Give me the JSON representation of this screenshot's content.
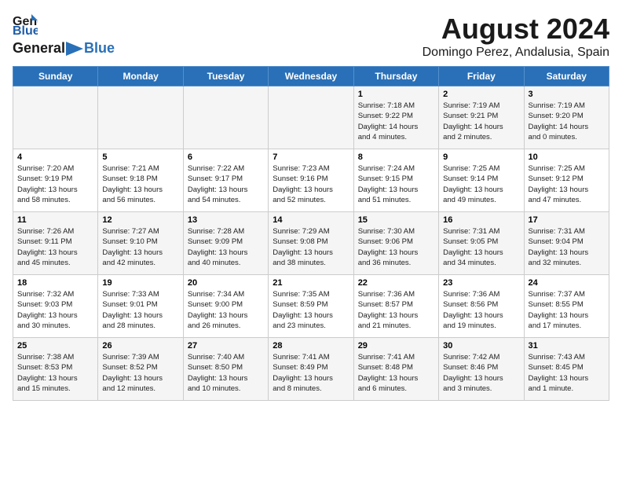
{
  "header": {
    "logo_general": "General",
    "logo_blue": "Blue",
    "month_year": "August 2024",
    "subtitle": "Domingo Perez, Andalusia, Spain"
  },
  "weekdays": [
    "Sunday",
    "Monday",
    "Tuesday",
    "Wednesday",
    "Thursday",
    "Friday",
    "Saturday"
  ],
  "weeks": [
    [
      {
        "day": "",
        "info": ""
      },
      {
        "day": "",
        "info": ""
      },
      {
        "day": "",
        "info": ""
      },
      {
        "day": "",
        "info": ""
      },
      {
        "day": "1",
        "info": "Sunrise: 7:18 AM\nSunset: 9:22 PM\nDaylight: 14 hours\nand 4 minutes."
      },
      {
        "day": "2",
        "info": "Sunrise: 7:19 AM\nSunset: 9:21 PM\nDaylight: 14 hours\nand 2 minutes."
      },
      {
        "day": "3",
        "info": "Sunrise: 7:19 AM\nSunset: 9:20 PM\nDaylight: 14 hours\nand 0 minutes."
      }
    ],
    [
      {
        "day": "4",
        "info": "Sunrise: 7:20 AM\nSunset: 9:19 PM\nDaylight: 13 hours\nand 58 minutes."
      },
      {
        "day": "5",
        "info": "Sunrise: 7:21 AM\nSunset: 9:18 PM\nDaylight: 13 hours\nand 56 minutes."
      },
      {
        "day": "6",
        "info": "Sunrise: 7:22 AM\nSunset: 9:17 PM\nDaylight: 13 hours\nand 54 minutes."
      },
      {
        "day": "7",
        "info": "Sunrise: 7:23 AM\nSunset: 9:16 PM\nDaylight: 13 hours\nand 52 minutes."
      },
      {
        "day": "8",
        "info": "Sunrise: 7:24 AM\nSunset: 9:15 PM\nDaylight: 13 hours\nand 51 minutes."
      },
      {
        "day": "9",
        "info": "Sunrise: 7:25 AM\nSunset: 9:14 PM\nDaylight: 13 hours\nand 49 minutes."
      },
      {
        "day": "10",
        "info": "Sunrise: 7:25 AM\nSunset: 9:12 PM\nDaylight: 13 hours\nand 47 minutes."
      }
    ],
    [
      {
        "day": "11",
        "info": "Sunrise: 7:26 AM\nSunset: 9:11 PM\nDaylight: 13 hours\nand 45 minutes."
      },
      {
        "day": "12",
        "info": "Sunrise: 7:27 AM\nSunset: 9:10 PM\nDaylight: 13 hours\nand 42 minutes."
      },
      {
        "day": "13",
        "info": "Sunrise: 7:28 AM\nSunset: 9:09 PM\nDaylight: 13 hours\nand 40 minutes."
      },
      {
        "day": "14",
        "info": "Sunrise: 7:29 AM\nSunset: 9:08 PM\nDaylight: 13 hours\nand 38 minutes."
      },
      {
        "day": "15",
        "info": "Sunrise: 7:30 AM\nSunset: 9:06 PM\nDaylight: 13 hours\nand 36 minutes."
      },
      {
        "day": "16",
        "info": "Sunrise: 7:31 AM\nSunset: 9:05 PM\nDaylight: 13 hours\nand 34 minutes."
      },
      {
        "day": "17",
        "info": "Sunrise: 7:31 AM\nSunset: 9:04 PM\nDaylight: 13 hours\nand 32 minutes."
      }
    ],
    [
      {
        "day": "18",
        "info": "Sunrise: 7:32 AM\nSunset: 9:03 PM\nDaylight: 13 hours\nand 30 minutes."
      },
      {
        "day": "19",
        "info": "Sunrise: 7:33 AM\nSunset: 9:01 PM\nDaylight: 13 hours\nand 28 minutes."
      },
      {
        "day": "20",
        "info": "Sunrise: 7:34 AM\nSunset: 9:00 PM\nDaylight: 13 hours\nand 26 minutes."
      },
      {
        "day": "21",
        "info": "Sunrise: 7:35 AM\nSunset: 8:59 PM\nDaylight: 13 hours\nand 23 minutes."
      },
      {
        "day": "22",
        "info": "Sunrise: 7:36 AM\nSunset: 8:57 PM\nDaylight: 13 hours\nand 21 minutes."
      },
      {
        "day": "23",
        "info": "Sunrise: 7:36 AM\nSunset: 8:56 PM\nDaylight: 13 hours\nand 19 minutes."
      },
      {
        "day": "24",
        "info": "Sunrise: 7:37 AM\nSunset: 8:55 PM\nDaylight: 13 hours\nand 17 minutes."
      }
    ],
    [
      {
        "day": "25",
        "info": "Sunrise: 7:38 AM\nSunset: 8:53 PM\nDaylight: 13 hours\nand 15 minutes."
      },
      {
        "day": "26",
        "info": "Sunrise: 7:39 AM\nSunset: 8:52 PM\nDaylight: 13 hours\nand 12 minutes."
      },
      {
        "day": "27",
        "info": "Sunrise: 7:40 AM\nSunset: 8:50 PM\nDaylight: 13 hours\nand 10 minutes."
      },
      {
        "day": "28",
        "info": "Sunrise: 7:41 AM\nSunset: 8:49 PM\nDaylight: 13 hours\nand 8 minutes."
      },
      {
        "day": "29",
        "info": "Sunrise: 7:41 AM\nSunset: 8:48 PM\nDaylight: 13 hours\nand 6 minutes."
      },
      {
        "day": "30",
        "info": "Sunrise: 7:42 AM\nSunset: 8:46 PM\nDaylight: 13 hours\nand 3 minutes."
      },
      {
        "day": "31",
        "info": "Sunrise: 7:43 AM\nSunset: 8:45 PM\nDaylight: 13 hours\nand 1 minute."
      }
    ]
  ]
}
